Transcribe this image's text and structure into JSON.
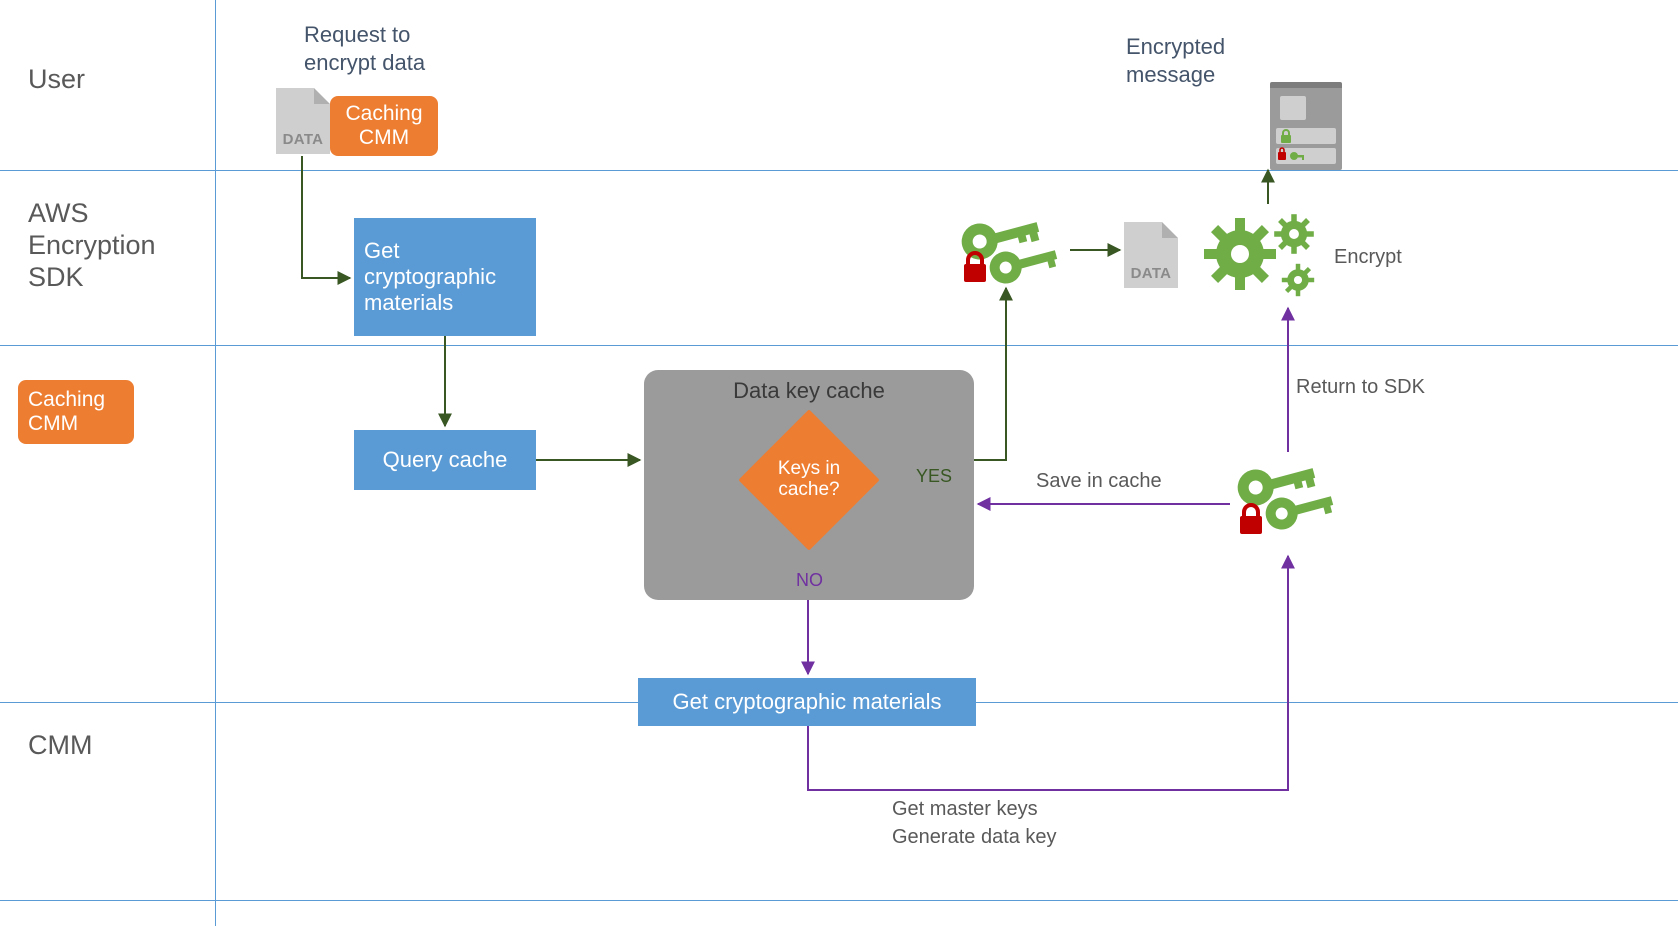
{
  "lanes": {
    "user": "User",
    "sdk1": "AWS",
    "sdk2": "Encryption",
    "sdk3": "SDK",
    "cachingCmm": "Caching\nCMM",
    "cmm": "CMM"
  },
  "top": {
    "request1": "Request to",
    "request2": "encrypt data",
    "dataTag": "DATA",
    "cachingCmmBadge": "Caching\nCMM",
    "encrypted1": "Encrypted",
    "encrypted2": "message"
  },
  "sdk": {
    "getMaterials": "Get\ncryptographic\nmaterials",
    "encrypt": "Encrypt",
    "dataTag": "DATA"
  },
  "cache": {
    "queryCache": "Query cache",
    "boxTitle": "Data key cache",
    "decision": "Keys in\ncache?",
    "yes": "YES",
    "no": "NO",
    "saveInCache": "Save in cache",
    "returnToSdk": "Return to SDK"
  },
  "cmmLane": {
    "getMaterials": "Get cryptographic materials",
    "action1": "Get master keys",
    "action2": "Generate data key"
  }
}
